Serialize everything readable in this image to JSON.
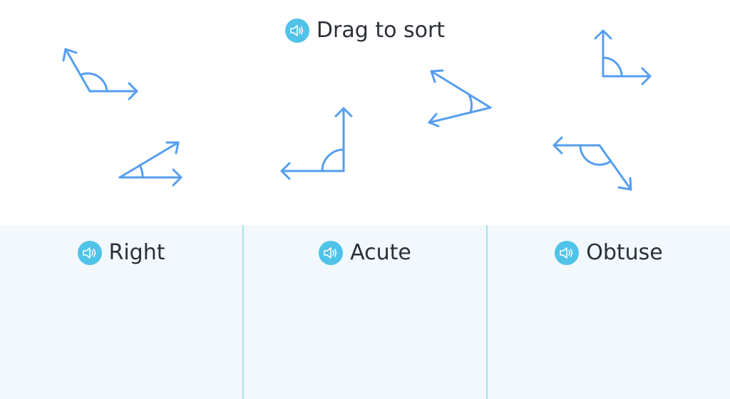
{
  "prompt": {
    "text": "Drag to sort",
    "icon": "speaker-icon"
  },
  "colors": {
    "angle_stroke": "#559ef0",
    "speaker_bg": "#4fc3e8",
    "bin_bg": "#f2f8fc",
    "bin_divider": "#a6e1ec",
    "text": "#2b2f36"
  },
  "bins": [
    {
      "label": "Right",
      "icon": "speaker-icon"
    },
    {
      "label": "Acute",
      "icon": "speaker-icon"
    },
    {
      "label": "Obtuse",
      "icon": "speaker-icon"
    }
  ],
  "angles": [
    {
      "name": "obtuse-angle-1",
      "kind": "obtuse"
    },
    {
      "name": "acute-angle-1",
      "kind": "acute"
    },
    {
      "name": "right-angle-1",
      "kind": "right"
    },
    {
      "name": "acute-angle-2",
      "kind": "acute"
    },
    {
      "name": "right-angle-2",
      "kind": "right"
    },
    {
      "name": "obtuse-angle-2",
      "kind": "obtuse"
    }
  ]
}
